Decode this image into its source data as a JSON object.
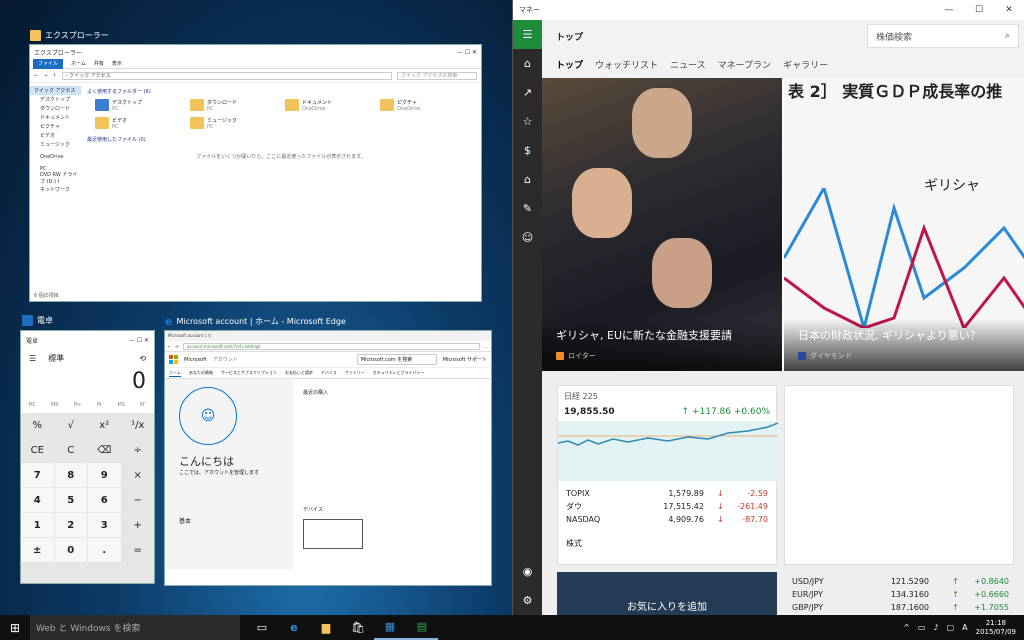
{
  "explorer": {
    "title": "エクスプローラー",
    "ribbon": [
      "ファイル",
      "ホーム",
      "共有",
      "表示"
    ],
    "address": "› クイック アクセス",
    "search_placeholder": "クイック アクセスの検索",
    "nav": [
      "クイック アクセス",
      "デスクトップ",
      "ダウンロード",
      "ドキュメント",
      "ピクチャ",
      "ビデオ",
      "ミュージック",
      "OneDrive",
      "PC",
      "DVD RW ドライブ (D:) I",
      "ネットワーク"
    ],
    "frequent_header": "よく使用するフォルダー (6)",
    "folders": [
      {
        "name": "デスクトップ",
        "sub": "PC"
      },
      {
        "name": "ダウンロード",
        "sub": "PC"
      },
      {
        "name": "ドキュメント",
        "sub": "OneDrive"
      },
      {
        "name": "ピクチャ",
        "sub": "OneDrive"
      },
      {
        "name": "ビデオ",
        "sub": "PC"
      },
      {
        "name": "ミュージック",
        "sub": "PC"
      }
    ],
    "recent_header": "最近使用したファイル (0)",
    "recent_empty": "ファイルをいくつか開いたら、ここに最近使ったファイルが表示されます。",
    "status": "6 個の項目"
  },
  "calc": {
    "label": "電卓",
    "mode": "標準",
    "display": "0",
    "memory": [
      "MC",
      "MR",
      "M+",
      "M-",
      "MS",
      "M˅"
    ],
    "keys": [
      "%",
      "√",
      "x²",
      "¹/x",
      "CE",
      "C",
      "⌫",
      "÷",
      "7",
      "8",
      "9",
      "×",
      "4",
      "5",
      "6",
      "−",
      "1",
      "2",
      "3",
      "+",
      "±",
      "0",
      ".",
      "="
    ]
  },
  "edge": {
    "label": "Microsoft account | ホーム - Microsoft Edge",
    "tab": "Microsoft account | ホ",
    "url": "account.microsoft.com/?ref=settings",
    "brand": "Microsoft",
    "brand_sub": "アカウント",
    "search": "Microsoft.com を検索",
    "support": "Microsoft サポート",
    "menu": [
      "ホーム",
      "あなたの情報",
      "サービスとサブスクリプション",
      "お支払いと請求",
      "デバイス",
      "ファミリー",
      "セキュリティとプライバシー"
    ],
    "greeting": "こんにちは",
    "greeting_sub": "ここでは、アカウントを管理します",
    "purchases": "最近の購入",
    "devices": "デバイス",
    "basic": "基本"
  },
  "money": {
    "app": "マネー",
    "title": "トップ",
    "search": "株価検索",
    "tabs": [
      "トップ",
      "ウォッチリスト",
      "ニュース",
      "マネープラン",
      "ギャラリー"
    ],
    "news": [
      {
        "headline": "ギリシャ, EUに新たな金融支援要請",
        "source": "ロイター"
      },
      {
        "headline": "日本の財政状況, ギリシャより悪い？",
        "source": "ダイヤモンド",
        "chart_label": "ギリシャ",
        "chart_title": "表 2］ 実質ＧＤＰ成長率の推"
      }
    ],
    "index": {
      "name": "日経 225",
      "value": "19,855.50",
      "change": "↑ +117.86",
      "pct": "+0.60%"
    },
    "stocks": [
      {
        "name": "TOPIX",
        "value": "1,579.89",
        "change": "-2.59"
      },
      {
        "name": "ダウ",
        "value": "17,515.42",
        "change": "-261.49"
      },
      {
        "name": "NASDAQ",
        "value": "4,909.76",
        "change": "-87.70"
      }
    ],
    "stocks_footer": "株式",
    "fav": "お気に入りを追加",
    "fx": [
      {
        "pair": "USD/JPY",
        "value": "121.5290",
        "change": "+0.8640"
      },
      {
        "pair": "EUR/JPY",
        "value": "134.3160",
        "change": "+0.6660"
      },
      {
        "pair": "GBP/JPY",
        "value": "187.1600",
        "change": "+1.7055"
      }
    ]
  },
  "taskbar": {
    "search": "Web と Windows を検索",
    "time": "21:18",
    "date": "2015/07/09",
    "ime": "A"
  }
}
